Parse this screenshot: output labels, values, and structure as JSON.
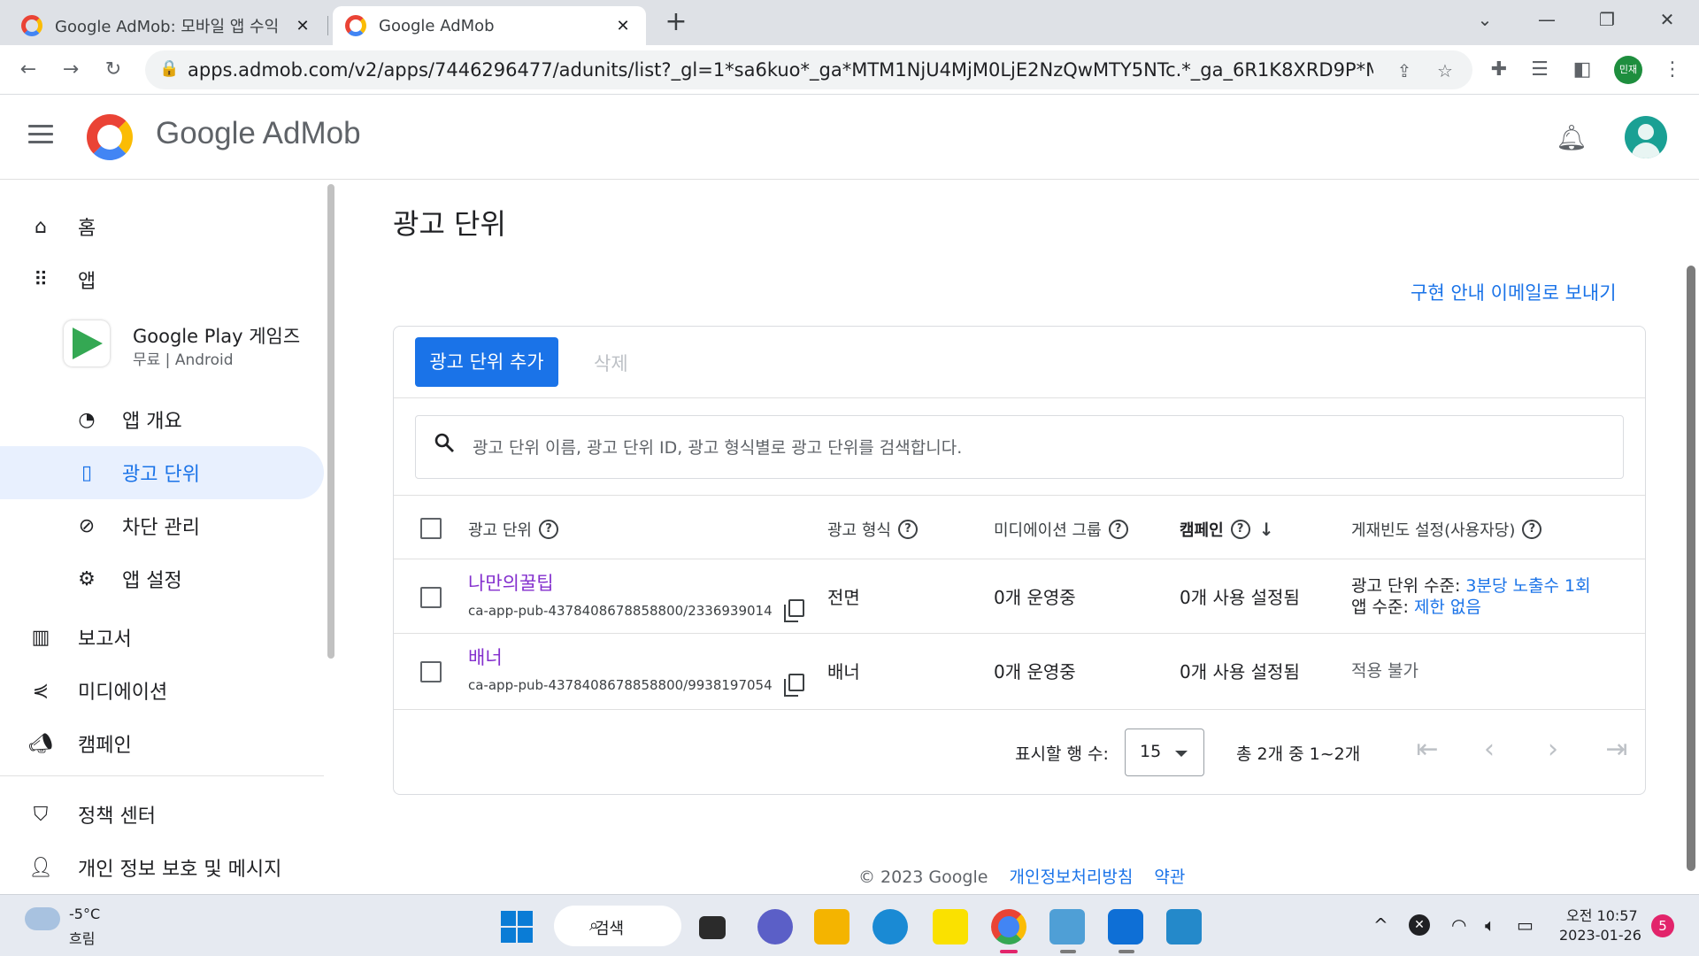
{
  "browser": {
    "tabs": [
      {
        "title": "Google AdMob: 모바일 앱 수익",
        "active": false
      },
      {
        "title": "Google AdMob",
        "active": true
      }
    ],
    "url": "apps.admob.com/v2/apps/7446296477/adunits/list?_gl=1*sa6kuo*_ga*MTM1NjU4MjM0LjE2NzQwMTY5NTc.*_ga_6R1K8XRD9P*MTY3NDY5...",
    "profile_label": "민재"
  },
  "header": {
    "brand": "Google AdMob"
  },
  "sidebar": {
    "home": "홈",
    "apps": "앱",
    "app": {
      "name": "Google Play 게임즈",
      "meta": "무료 | Android"
    },
    "sub_items": [
      {
        "label": "앱 개요",
        "icon": "speedometer-icon"
      },
      {
        "label": "광고 단위",
        "icon": "ad-unit-icon",
        "selected": true
      },
      {
        "label": "차단 관리",
        "icon": "block-icon"
      },
      {
        "label": "앱 설정",
        "icon": "app-settings-icon"
      }
    ],
    "reports": "보고서",
    "mediation": "미디에이션",
    "campaigns": "캠페인",
    "policy": "정책 센터",
    "privacy": "개인 정보 보호 및 메시지"
  },
  "main": {
    "title": "광고 단위",
    "send_link": "구현 안내 이메일로 보내기",
    "add_button": "광고 단위 추가",
    "delete_button": "삭제",
    "search_placeholder": "광고 단위 이름, 광고 단위 ID, 광고 형식별로 광고 단위를 검색합니다.",
    "columns": [
      "광고 단위",
      "광고 형식",
      "미디에이션 그룹",
      "캠페인",
      "게재빈도 설정(사용자당)"
    ],
    "rows": [
      {
        "name": "나만의꿀팁",
        "id": "ca-app-pub-4378408678858800/2336939014",
        "format": "전면",
        "mediation": "0개 운영중",
        "campaign": "0개 사용 설정됨",
        "cap_unit_label": "광고 단위 수준:",
        "cap_unit_value": "3분당 노출수 1회",
        "cap_app_label": "앱 수준:",
        "cap_app_value": "제한 없음"
      },
      {
        "name": "배너",
        "id": "ca-app-pub-4378408678858800/9938197054",
        "format": "배너",
        "mediation": "0개 운영중",
        "campaign": "0개 사용 설정됨",
        "cap_na": "적용 불가"
      }
    ],
    "pagination": {
      "rows_label": "표시할 행 수:",
      "rows_value": "15",
      "range": "총 2개 중 1~2개"
    }
  },
  "footer": {
    "copyright": "© 2023 Google",
    "privacy": "개인정보처리방침",
    "terms": "약관"
  },
  "taskbar": {
    "temp": "-5°C",
    "condition": "흐림",
    "search": "검색",
    "time": "오전 10:57",
    "date": "2023-01-26",
    "notifications": "5"
  },
  "colors": {
    "accent": "#1a73e8",
    "link_visited": "#8430ce",
    "selected_bg": "#e8f0fe"
  }
}
